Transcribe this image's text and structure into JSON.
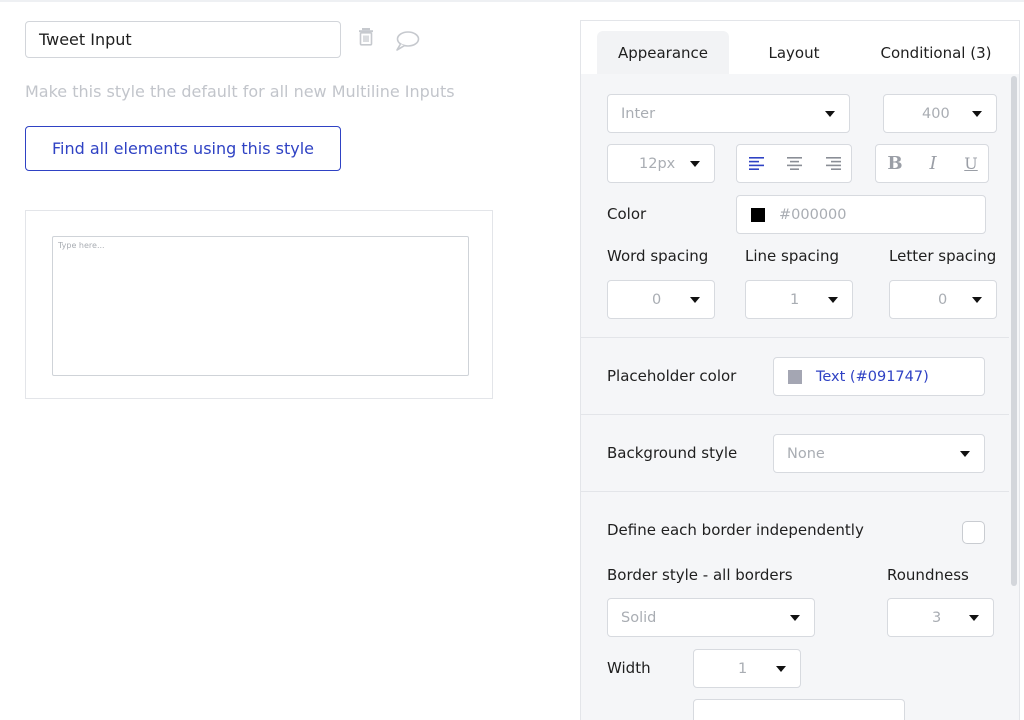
{
  "style_editor": {
    "style_name": "Tweet Input",
    "make_default_text": "Make this style the default for all new Multiline Inputs",
    "find_elements_label": "Find all elements using this style"
  },
  "preview": {
    "placeholder": "Type here..."
  },
  "tabs": {
    "appearance": "Appearance",
    "layout": "Layout",
    "conditional": "Conditional (3)"
  },
  "font": {
    "family": "Inter",
    "weight": "400",
    "size": "12px",
    "bold_glyph": "B",
    "italic_glyph": "I",
    "underline_glyph": "U"
  },
  "color": {
    "label": "Color",
    "value": "#000000",
    "swatch_color": "#000000"
  },
  "spacing": {
    "word_label": "Word spacing",
    "line_label": "Line spacing",
    "letter_label": "Letter spacing",
    "word_value": "0",
    "line_value": "1",
    "letter_value": "0"
  },
  "placeholder_color": {
    "label": "Placeholder color",
    "value": "Text (#091747)",
    "swatch_color": "#a4a6b3"
  },
  "background": {
    "label": "Background style",
    "value": "None"
  },
  "border": {
    "independent_label": "Define each border independently",
    "independent_checked": false,
    "style_label": "Border style - all borders",
    "style_value": "Solid",
    "roundness_label": "Roundness",
    "roundness_value": "3",
    "width_label": "Width",
    "width_value": "1"
  },
  "colors": {
    "accent": "#2f42c4",
    "panel_bg": "#f5f6f8",
    "placeholder_gray": "#a9adb3"
  }
}
